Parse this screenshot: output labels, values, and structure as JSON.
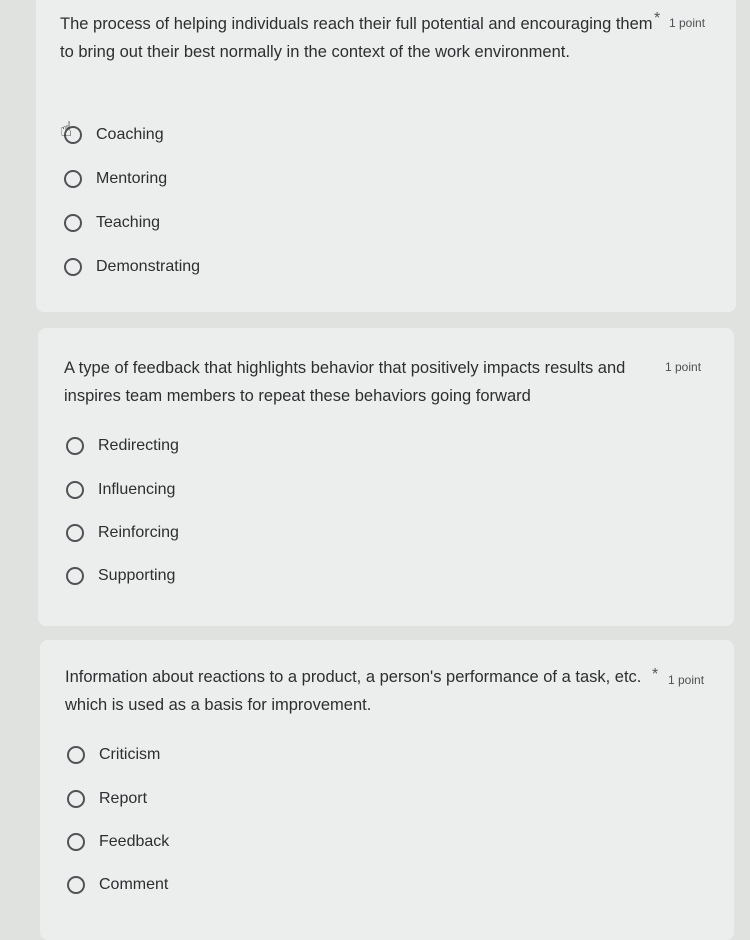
{
  "questions": [
    {
      "text": "The process of helping individuals reach their full potential and encouraging them to bring out their best normally in the context of the work environment.",
      "required_mark": "*",
      "points": "1 point",
      "options": [
        "Coaching",
        "Mentoring",
        "Teaching",
        "Demonstrating"
      ]
    },
    {
      "text": "A type of feedback that highlights behavior that positively impacts results and inspires team members to repeat these behaviors going forward",
      "points": "1 point",
      "options": [
        "Redirecting",
        "Influencing",
        "Reinforcing",
        "Supporting"
      ]
    },
    {
      "text": "Information about reactions to a product, a person's performance of a task, etc. which is used as a basis for improvement.",
      "required_mark": "*",
      "points": "1 point",
      "options": [
        "Criticism",
        "Report",
        "Feedback",
        "Comment"
      ]
    }
  ],
  "icons": {
    "cursor": "hand-cursor-icon"
  }
}
